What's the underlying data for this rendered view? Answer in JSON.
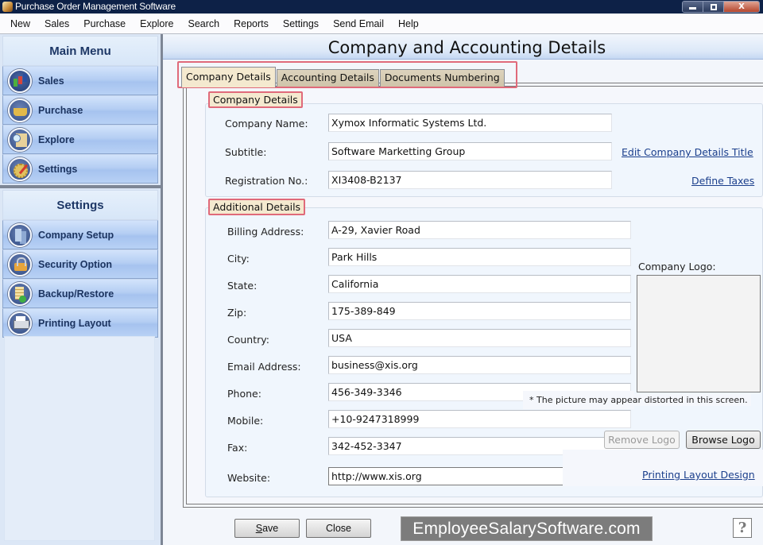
{
  "window": {
    "title": "Purchase Order Management Software",
    "controls": {
      "minimize": "minimize-icon",
      "maximize": "maximize-icon",
      "close": "close-icon",
      "close_glyph": "X"
    }
  },
  "menubar": {
    "items": [
      "New",
      "Sales",
      "Purchase",
      "Explore",
      "Search",
      "Reports",
      "Settings",
      "Send Email",
      "Help"
    ]
  },
  "sidebar": {
    "main_menu": {
      "title": "Main Menu",
      "items": [
        {
          "label": "Sales",
          "icon": "sales-chart-icon"
        },
        {
          "label": "Purchase",
          "icon": "basket-icon"
        },
        {
          "label": "Explore",
          "icon": "explore-magnifier-icon"
        },
        {
          "label": "Settings",
          "icon": "settings-gear-icon"
        }
      ]
    },
    "settings_menu": {
      "title": "Settings",
      "items": [
        {
          "label": "Company Setup",
          "icon": "company-building-icon"
        },
        {
          "label": "Security Option",
          "icon": "lock-icon"
        },
        {
          "label": "Backup/Restore",
          "icon": "backup-database-icon"
        },
        {
          "label": "Printing Layout",
          "icon": "printer-icon"
        }
      ]
    }
  },
  "main": {
    "title": "Company and Accounting Details",
    "tabs": [
      {
        "label": "Company Details",
        "active": true
      },
      {
        "label": "Accounting Details",
        "active": false
      },
      {
        "label": "Documents Numbering",
        "active": false
      }
    ],
    "company_details": {
      "legend": "Company Details",
      "fields": [
        {
          "label": "Company Name:",
          "value": "Xymox Informatic Systems Ltd."
        },
        {
          "label": "Subtitle:",
          "value": "Software Marketting Group"
        },
        {
          "label": "Registration No.:",
          "value": "XI3408-B2137"
        }
      ],
      "links": {
        "edit_title": "Edit Company Details Title",
        "define_taxes": "Define Taxes"
      }
    },
    "additional_details": {
      "legend": "Additional Details",
      "fields": [
        {
          "label": "Billing Address:",
          "value": "A-29, Xavier Road"
        },
        {
          "label": "City:",
          "value": "Park Hills"
        },
        {
          "label": "State:",
          "value": "California"
        },
        {
          "label": "Zip:",
          "value": "175-389-849"
        },
        {
          "label": "Country:",
          "value": "USA"
        },
        {
          "label": "Email Address:",
          "value": "business@xis.org"
        },
        {
          "label": "Phone:",
          "value": "456-349-3346"
        },
        {
          "label": "Mobile:",
          "value": "+10-9247318999"
        },
        {
          "label": "Fax:",
          "value": "342-452-3347"
        },
        {
          "label": "Website:",
          "value": "http://www.xis.org"
        }
      ],
      "logo": {
        "label": "Company Logo:",
        "note": "* The picture may appear distorted in this screen.",
        "remove_button": "Remove Logo",
        "remove_enabled": false,
        "browse_button": "Browse Logo"
      },
      "links": {
        "printing_layout": "Printing Layout Design"
      }
    },
    "footer": {
      "save_prefix": "S",
      "save_rest": "ave",
      "close_label": "Close",
      "watermark": "EmployeeSalarySoftware.com",
      "help_glyph": "?"
    }
  },
  "colors": {
    "highlight_border": "#e06a7a",
    "tab_active_bg": "#f4e9cf",
    "link": "#1b3f8c",
    "titlebar": "#0d2147",
    "sidebar_heading": "#1d3766"
  }
}
